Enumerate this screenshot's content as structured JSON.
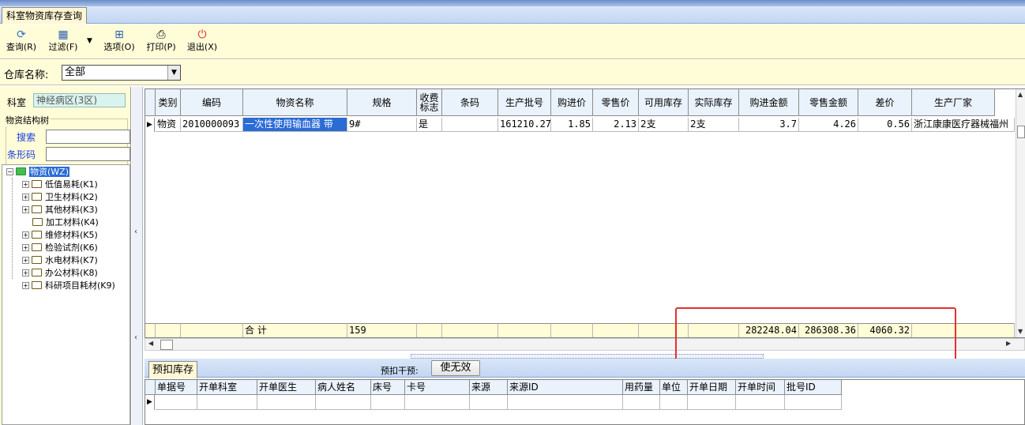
{
  "window": {
    "tab_title": "科室物资库存查询"
  },
  "toolbar": {
    "query": "查询(R)",
    "filter": "过滤(F)",
    "options": "选项(O)",
    "print": "打印(P)",
    "exit": "退出(X)"
  },
  "warehouse": {
    "label": "仓库名称:",
    "value": "全部"
  },
  "left": {
    "dept_label": "科室",
    "dept_value": "神经病区(3区)",
    "group_title": "物资结构树",
    "search_label": "搜索",
    "barcode_label": "条形码",
    "tree": {
      "root": "物资(WZ)",
      "children": [
        "低值易耗(K1)",
        "卫生材料(K2)",
        "其他材料(K3)",
        "加工材料(K4)",
        "维修材料(K5)",
        "检验试剂(K6)",
        "水电材料(K7)",
        "办公材料(K8)",
        "科研项目耗材(K9)"
      ]
    }
  },
  "grid": {
    "headers": [
      "类别",
      "编码",
      "物资名称",
      "规格",
      "收费标志",
      "条码",
      "生产批号",
      "购进价",
      "零售价",
      "可用库存",
      "实际库存",
      "购进金额",
      "零售金额",
      "差价",
      "生产厂家"
    ],
    "row": {
      "category": "物资",
      "code": "2010000093",
      "name": "一次性使用输血器 带",
      "spec": "9#",
      "charge_flag": "是",
      "barcode": "",
      "batch": "161210.27",
      "purchase_price": "1.85",
      "retail_price": "2.13",
      "available_stock": "2支",
      "actual_stock": "2支",
      "purchase_amount": "3.7",
      "retail_amount": "4.26",
      "difference": "0.56",
      "manufacturer": "浙江康康医疗器械福州"
    },
    "summary": {
      "label": "合  计",
      "spec_total": "159",
      "purchase_amount": "282248.04",
      "retail_amount": "286308.36",
      "difference": "4060.32"
    }
  },
  "bottom": {
    "tab": "预扣库存",
    "withhold_label": "预扣干预:",
    "withhold_button": "使无效",
    "headers": [
      "单据号",
      "开单科室",
      "开单医生",
      "病人姓名",
      "床号",
      "卡号",
      "来源",
      "来源ID",
      "用药量",
      "单位",
      "开单日期",
      "开单时间",
      "批号ID"
    ]
  },
  "colors": {
    "toolbar_bg": "#fffcd8",
    "selection": "#2a6bd6",
    "highlight_box": "#e53030",
    "dept_bg": "#d9f4ee"
  }
}
